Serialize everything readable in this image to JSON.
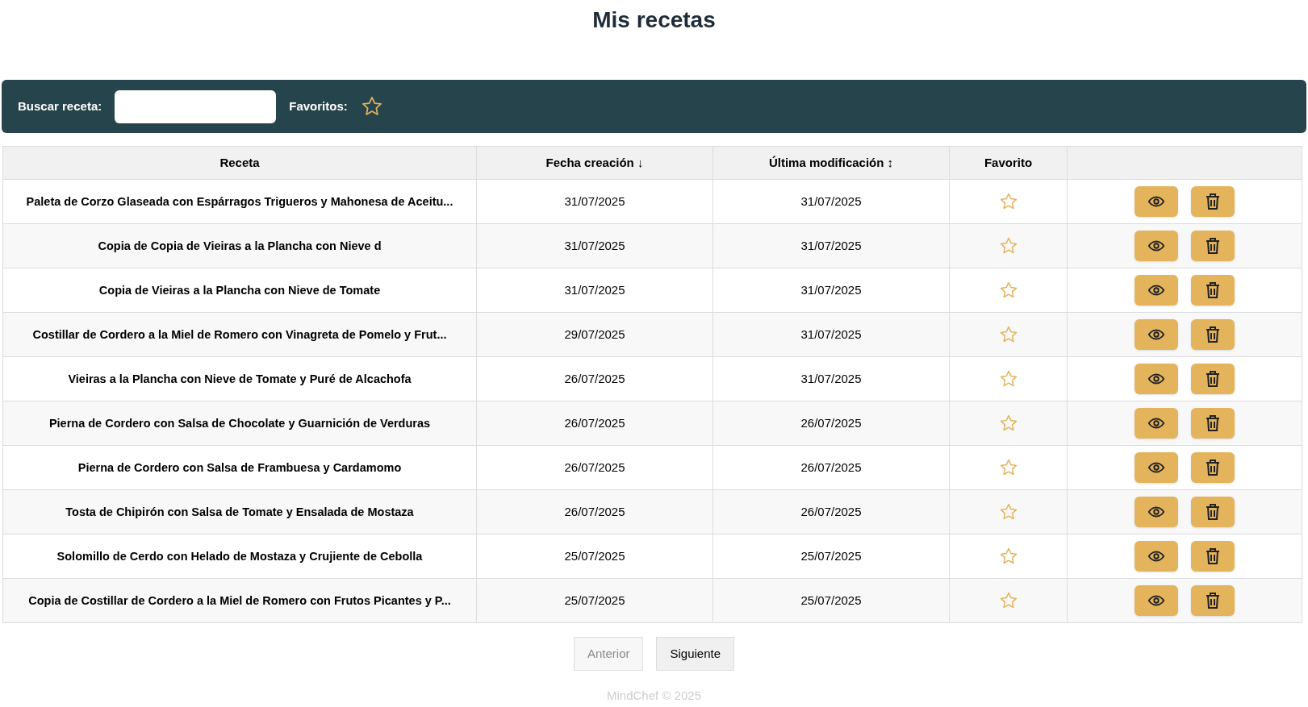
{
  "title": "Mis recetas",
  "toolbar": {
    "search_label": "Buscar receta:",
    "favorites_label": "Favoritos:",
    "favorites_filter": false
  },
  "table": {
    "columns": [
      {
        "label": "Receta"
      },
      {
        "label": "Fecha creación",
        "sort": "↓"
      },
      {
        "label": "Última modificación",
        "sort": "↕"
      },
      {
        "label": "Favorito"
      }
    ],
    "rows": [
      {
        "name": "Paleta de Corzo Glaseada con Espárragos Trigueros y Mahonesa de Aceitu...",
        "created": "31/07/2025",
        "modified": "31/07/2025",
        "favorite": false
      },
      {
        "name": "Copia de Copia de Vieiras a la Plancha con Nieve d",
        "created": "31/07/2025",
        "modified": "31/07/2025",
        "favorite": false
      },
      {
        "name": "Copia de Vieiras a la Plancha con Nieve de Tomate",
        "created": "31/07/2025",
        "modified": "31/07/2025",
        "favorite": false
      },
      {
        "name": "Costillar de Cordero a la Miel de Romero con Vinagreta de Pomelo y Frut...",
        "created": "29/07/2025",
        "modified": "31/07/2025",
        "favorite": false
      },
      {
        "name": "Vieiras a la Plancha con Nieve de Tomate y Puré de Alcachofa",
        "created": "26/07/2025",
        "modified": "31/07/2025",
        "favorite": false
      },
      {
        "name": "Pierna de Cordero con Salsa de Chocolate y Guarnición de Verduras",
        "created": "26/07/2025",
        "modified": "26/07/2025",
        "favorite": false
      },
      {
        "name": "Pierna de Cordero con Salsa de Frambuesa y Cardamomo",
        "created": "26/07/2025",
        "modified": "26/07/2025",
        "favorite": false
      },
      {
        "name": "Tosta de Chipirón con Salsa de Tomate y Ensalada de Mostaza",
        "created": "26/07/2025",
        "modified": "26/07/2025",
        "favorite": false
      },
      {
        "name": "Solomillo de Cerdo con Helado de Mostaza y Crujiente de Cebolla",
        "created": "25/07/2025",
        "modified": "25/07/2025",
        "favorite": false
      },
      {
        "name": "Copia de Costillar de Cordero a la Miel de Romero con Frutos Picantes y P...",
        "created": "25/07/2025",
        "modified": "25/07/2025",
        "favorite": false
      }
    ]
  },
  "pagination": [
    {
      "label": "Anterior",
      "disabled": true
    },
    {
      "label": "Siguiente",
      "disabled": false
    }
  ],
  "footer": "MindChef © 2025"
}
